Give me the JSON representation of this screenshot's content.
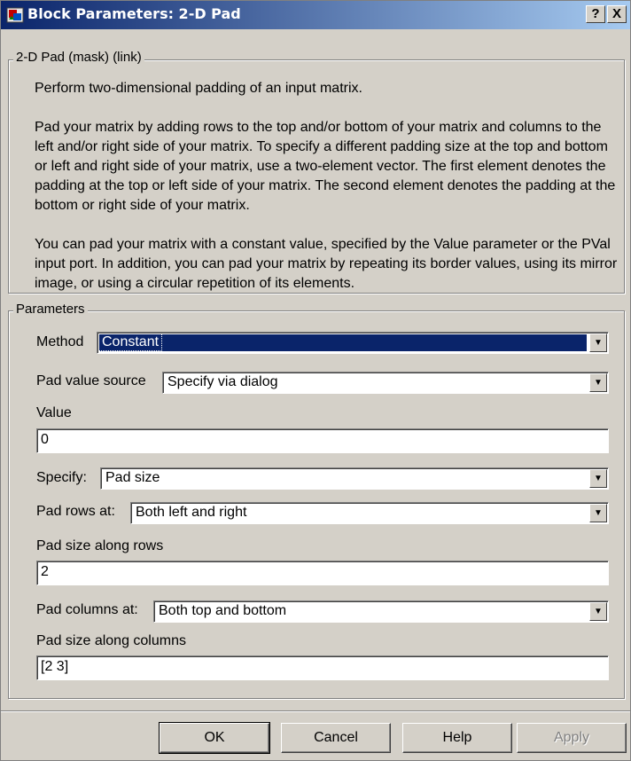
{
  "window": {
    "title": "Block Parameters: 2-D Pad",
    "help_glyph": "?",
    "close_glyph": "X"
  },
  "mask": {
    "legend": "2-D Pad (mask) (link)",
    "paragraph1": "Perform two-dimensional padding of an input matrix.",
    "paragraph2": "Pad your matrix by adding rows to the top and/or bottom of your matrix and columns to the left and/or right side of your matrix. To specify a different padding size at the top and bottom or left and right side of your matrix, use a two-element vector. The first element denotes the padding at the top or left side of your matrix. The second element denotes the padding at the bottom or right side of your matrix.",
    "paragraph3": "You can pad your matrix with a constant value, specified by the Value parameter or the PVal input port. In addition, you can pad your matrix by repeating its border values, using its mirror image, or using a circular repetition of its elements."
  },
  "parameters": {
    "legend": "Parameters",
    "method_label": "Method",
    "method_value": "Constant",
    "pad_value_source_label": "Pad value source",
    "pad_value_source_value": "Specify via dialog",
    "value_label": "Value",
    "value_value": "0",
    "specify_label": "Specify:",
    "specify_value": "Pad size",
    "pad_rows_at_label": "Pad rows at:",
    "pad_rows_at_value": "Both left and right",
    "pad_size_rows_label": "Pad size along rows",
    "pad_size_rows_value": "2",
    "pad_columns_at_label": "Pad columns at:",
    "pad_columns_at_value": "Both top and bottom",
    "pad_size_columns_label": "Pad size along columns",
    "pad_size_columns_value": "[2 3]"
  },
  "buttons": {
    "ok": "OK",
    "cancel": "Cancel",
    "help": "Help",
    "apply": "Apply"
  },
  "colors": {
    "title_bar": "#0a246a",
    "dialog_face": "#d4d0c8",
    "selection": "#0a246a"
  },
  "icons": {
    "title": "simulink-block-icon",
    "dropdown": "chevron-down-icon"
  }
}
